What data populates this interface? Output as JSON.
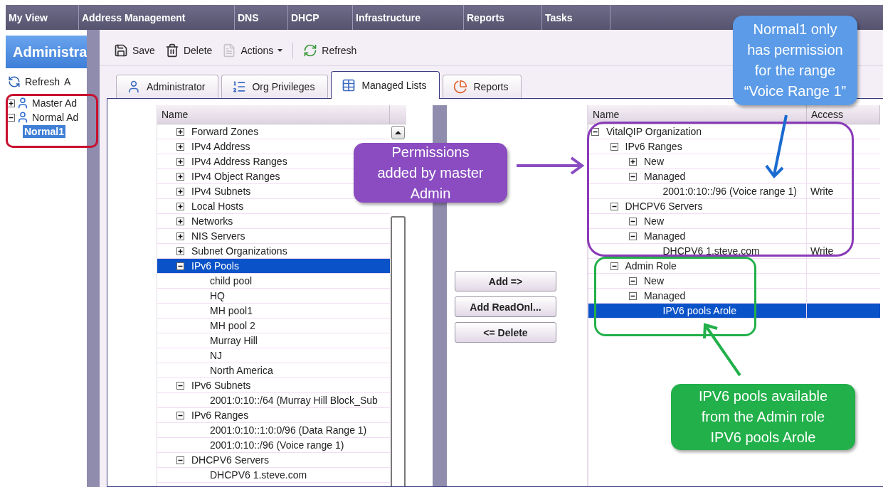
{
  "nav": [
    {
      "label": "My View"
    },
    {
      "label": "Address Management"
    },
    {
      "label": "DNS"
    },
    {
      "label": "DHCP"
    },
    {
      "label": "Infrastructure"
    },
    {
      "label": "Reports"
    },
    {
      "label": "Tasks"
    }
  ],
  "left_panel": {
    "title": "Administra",
    "toolbar": [
      "Refresh",
      "A"
    ],
    "tree": [
      {
        "label": "Master Ad",
        "expanded": false,
        "selected": false
      },
      {
        "label": "Normal Ad",
        "expanded": true,
        "selected": false,
        "children": [
          {
            "label": "Normal1",
            "selected": true
          }
        ]
      }
    ]
  },
  "toolbar": [
    {
      "label": "Save",
      "kind": "button"
    },
    {
      "label": "Delete",
      "kind": "button"
    },
    {
      "label": "Actions",
      "kind": "menu"
    },
    {
      "label": "Refresh",
      "kind": "button"
    }
  ],
  "tabs": [
    {
      "label": "Administrator",
      "selected": false
    },
    {
      "label": "Org Privileges",
      "selected": false
    },
    {
      "label": "Managed Lists",
      "selected": true
    },
    {
      "label": "Reports",
      "selected": false
    }
  ],
  "available": {
    "columns": [
      "Name"
    ],
    "rows": [
      {
        "label": "Forward Zones",
        "expanded": false,
        "selected": false
      },
      {
        "label": "IPv4 Address",
        "expanded": false,
        "selected": false
      },
      {
        "label": "IPv4 Address Ranges",
        "expanded": false,
        "selected": false
      },
      {
        "label": "IPv4 Object Ranges",
        "expanded": false,
        "selected": false
      },
      {
        "label": "IPv4 Subnets",
        "expanded": false,
        "selected": false
      },
      {
        "label": "Local Hosts",
        "expanded": false,
        "selected": false
      },
      {
        "label": "Networks",
        "expanded": false,
        "selected": false
      },
      {
        "label": "NIS Servers",
        "expanded": false,
        "selected": false
      },
      {
        "label": "Subnet Organizations",
        "expanded": false,
        "selected": false
      },
      {
        "label": "IPv6 Pools",
        "expanded": true,
        "selected": true,
        "children": [
          {
            "label": "child pool",
            "selected": false
          },
          {
            "label": "HQ",
            "selected": false
          },
          {
            "label": "MH pool1",
            "selected": false
          },
          {
            "label": "MH pool 2",
            "selected": false
          },
          {
            "label": "Murray Hill",
            "selected": false
          },
          {
            "label": "NJ",
            "selected": false
          },
          {
            "label": "North America",
            "selected": false
          }
        ]
      },
      {
        "label": "IPv6 Subnets",
        "expanded": true,
        "selected": false,
        "children": [
          {
            "label": "2001:0:10::/64 (Murray Hill Block_Sub",
            "selected": false
          }
        ]
      },
      {
        "label": "IPv6 Ranges",
        "expanded": true,
        "selected": false,
        "children": [
          {
            "label": "2001:0:10::1:0:0/96 (Data Range 1)",
            "selected": false
          },
          {
            "label": "2001:0:10::/96 (Voice range 1)",
            "selected": false
          }
        ]
      },
      {
        "label": "DHCPV6 Servers",
        "expanded": true,
        "selected": false,
        "children": [
          {
            "label": "DHCPV6 1.steve.com",
            "selected": false
          }
        ]
      }
    ]
  },
  "buttons": [
    "Add =>",
    "Add ReadOnl...",
    "<= Delete"
  ],
  "assigned": {
    "columns": [
      "Name",
      "Access"
    ],
    "rows": [
      {
        "label": "VitalQIP Organization",
        "expanded": true,
        "selected": false,
        "children": [
          {
            "label": "IPv6 Ranges",
            "expanded": true,
            "selected": false,
            "children": [
              {
                "label": "New",
                "expanded": false,
                "selected": false
              },
              {
                "label": "Managed",
                "expanded": true,
                "selected": false,
                "children": [
                  {
                    "label": "2001:0:10::/96 (Voice range 1)",
                    "access": "Write",
                    "selected": false
                  }
                ]
              }
            ]
          },
          {
            "label": "DHCPV6 Servers",
            "expanded": true,
            "selected": false,
            "children": [
              {
                "label": "New",
                "expanded": true,
                "selected": false
              },
              {
                "label": "Managed",
                "expanded": true,
                "selected": false,
                "children": [
                  {
                    "label": "DHCPV6 1.steve.com",
                    "access": "Write",
                    "selected": false
                  }
                ]
              }
            ]
          },
          {
            "label": "Admin Role",
            "expanded": true,
            "selected": false,
            "children": [
              {
                "label": "New",
                "expanded": true,
                "selected": false
              },
              {
                "label": "Managed",
                "expanded": true,
                "selected": false,
                "children": [
                  {
                    "label": "IPV6 pools Arole",
                    "selected": true
                  }
                ]
              }
            ]
          }
        ]
      }
    ]
  },
  "callouts": [
    {
      "text": "Permissions added by master Admin",
      "color": "#8a4cc0"
    },
    {
      "text": "Normal1 only has permission for the range “Voice Range 1”",
      "color": "#5b9be8"
    },
    {
      "text": "IPV6 pools available from the Admin role IPV6 pools Arole",
      "color": "#22b04a"
    }
  ]
}
